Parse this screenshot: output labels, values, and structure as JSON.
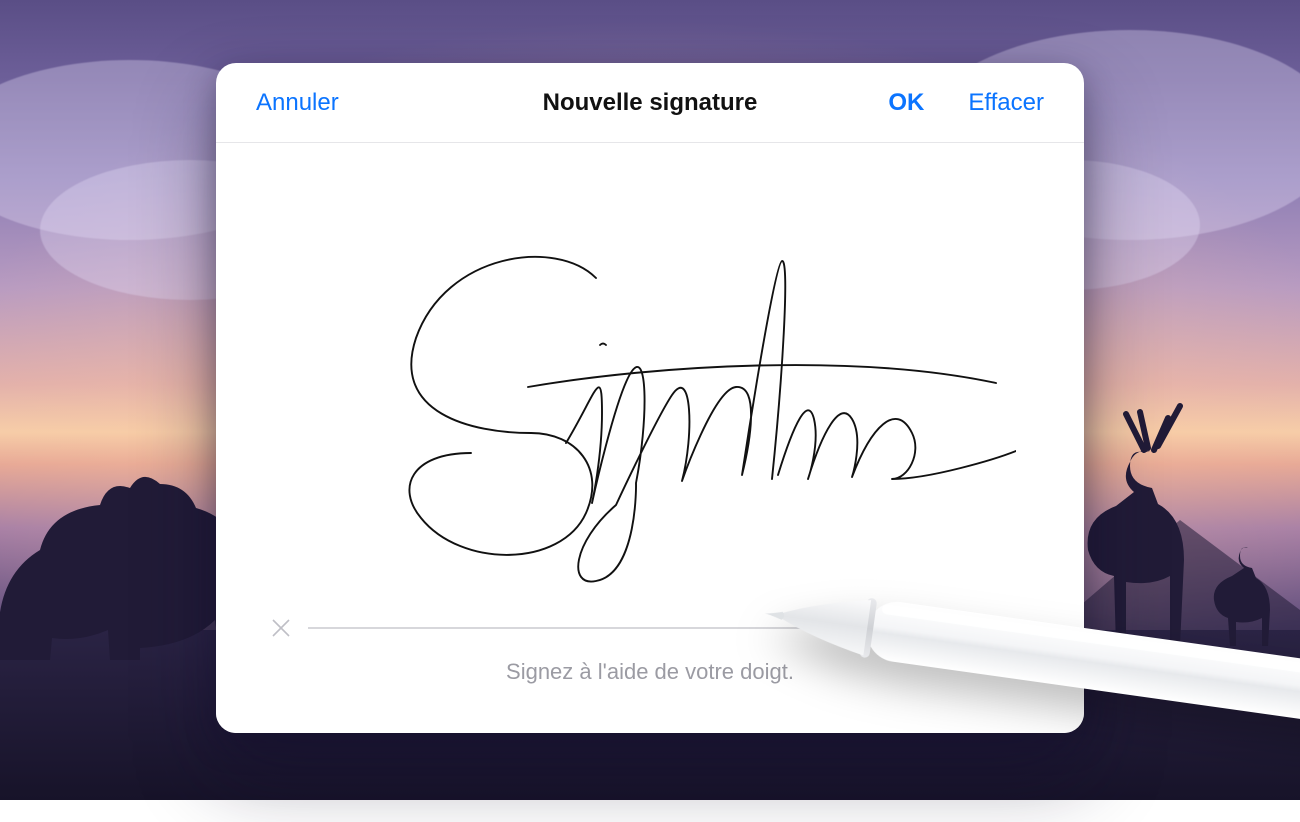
{
  "header": {
    "cancel": "Annuler",
    "title": "Nouvelle signature",
    "ok": "OK",
    "clear": "Effacer"
  },
  "canvas": {
    "signature_text": "Signature",
    "hint": "Signez à l'aide de votre doigt.",
    "clear_icon": "x-icon"
  },
  "stylus": {
    "name": "apple-pencil"
  }
}
